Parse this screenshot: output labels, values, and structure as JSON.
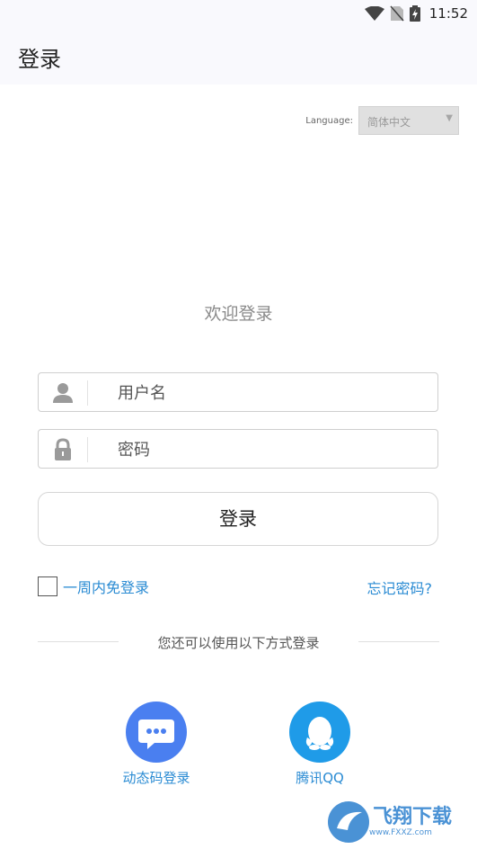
{
  "status_bar": {
    "time": "11:52"
  },
  "appbar": {
    "title": "登录"
  },
  "language": {
    "label": "Language:",
    "selected": "简体中文"
  },
  "welcome": "欢迎登录",
  "fields": {
    "username_placeholder": "用户名",
    "password_placeholder": "密码"
  },
  "login_button": "登录",
  "remember": {
    "label": "一周内免登录",
    "checked": false
  },
  "forgot_password": "忘记密码?",
  "other_methods": "您还可以使用以下方式登录",
  "alt_logins": [
    {
      "label": "动态码登录",
      "icon": "chat-icon",
      "color": "#4a7ff0"
    },
    {
      "label": "腾讯QQ",
      "icon": "qq-icon",
      "color": "#1f9be8"
    }
  ],
  "watermark": {
    "title": "飞翔下载",
    "url": "www.FXXZ.com"
  },
  "colors": {
    "accent": "#2a8bd3"
  }
}
